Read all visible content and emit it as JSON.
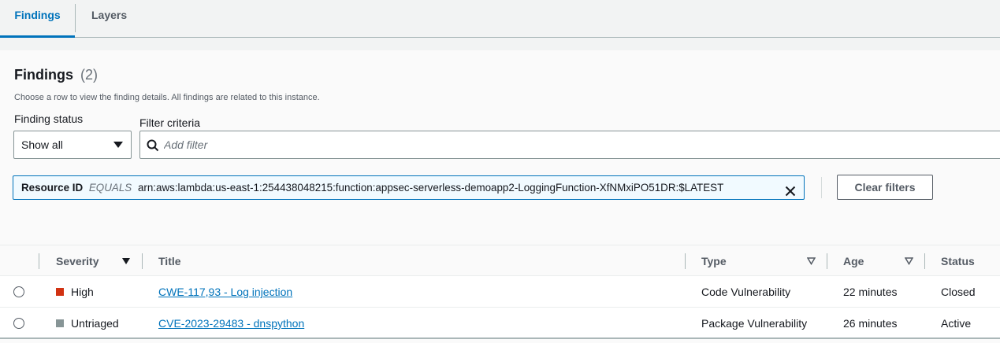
{
  "tabs": [
    {
      "label": "Findings",
      "active": true
    },
    {
      "label": "Layers",
      "active": false
    }
  ],
  "findings": {
    "title": "Findings",
    "count": "(2)",
    "description": "Choose a row to view the finding details. All findings are related to this instance."
  },
  "filters": {
    "status_label": "Finding status",
    "status_value": "Show all",
    "criteria_label": "Filter criteria",
    "criteria_placeholder": "Add filter",
    "token": {
      "key": "Resource ID",
      "operator": "EQUALS",
      "value": "arn:aws:lambda:us-east-1:254438048215:function:appsec-serverless-demoapp2-LoggingFunction-XfNMxiPO51DR:$LATEST"
    },
    "clear_label": "Clear filters"
  },
  "table": {
    "columns": {
      "severity": "Severity",
      "title": "Title",
      "type": "Type",
      "age": "Age",
      "status": "Status"
    },
    "rows": [
      {
        "severity": "High",
        "severity_color": "#d13212",
        "title": "CWE-117,93 - Log injection",
        "type": "Code Vulnerability",
        "age": "22 minutes",
        "status": "Closed"
      },
      {
        "severity": "Untriaged",
        "severity_color": "#879596",
        "title": "CVE-2023-29483 - dnspython",
        "type": "Package Vulnerability",
        "age": "26 minutes",
        "status": "Active"
      }
    ]
  },
  "colors": {
    "accent": "#0073bb",
    "high": "#d13212",
    "untriaged": "#879596"
  }
}
